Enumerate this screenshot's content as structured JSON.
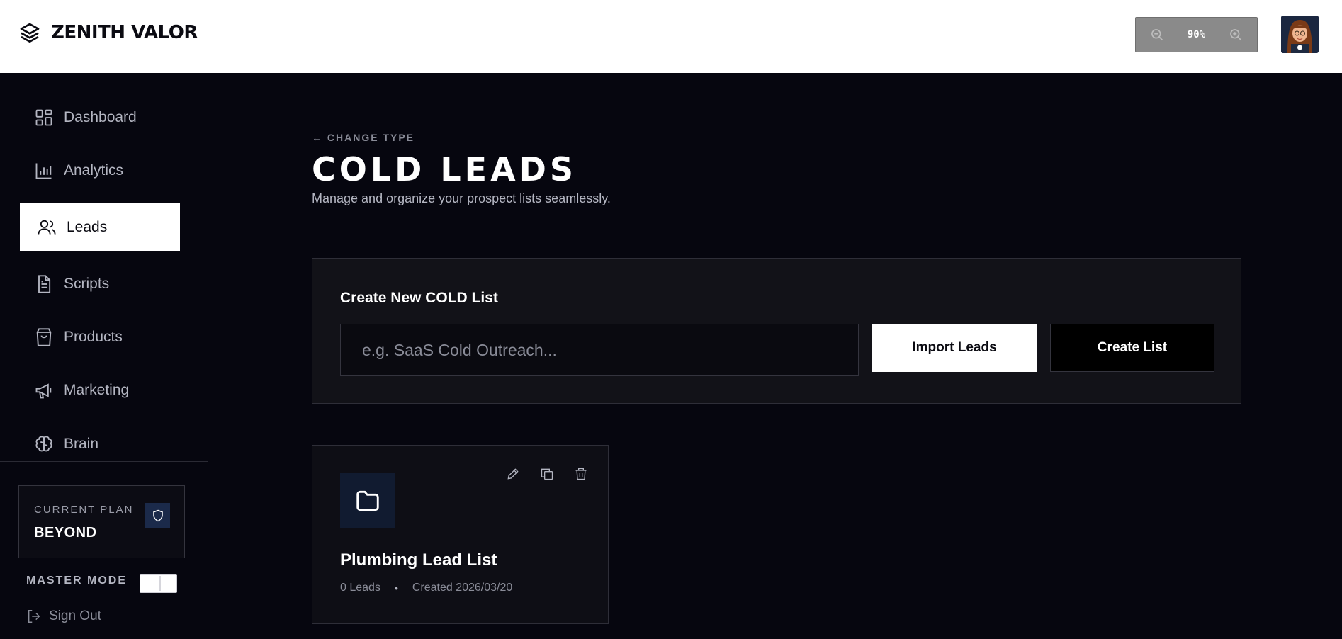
{
  "header": {
    "brand_name": "ZENITH VALOR",
    "zoom_level": "90%"
  },
  "sidebar": {
    "items": [
      {
        "label": "Dashboard",
        "icon": "dashboard-icon"
      },
      {
        "label": "Analytics",
        "icon": "bar-chart-icon"
      },
      {
        "label": "Leads",
        "icon": "users-icon",
        "active": true
      },
      {
        "label": "Scripts",
        "icon": "document-icon"
      },
      {
        "label": "Products",
        "icon": "shopping-bag-icon"
      },
      {
        "label": "Marketing",
        "icon": "megaphone-icon"
      },
      {
        "label": "Brain",
        "icon": "brain-icon"
      }
    ],
    "plan": {
      "label": "CURRENT PLAN",
      "name": "BEYOND"
    },
    "master_mode_label": "MASTER MODE",
    "sign_out_label": "Sign Out"
  },
  "main": {
    "back_label": "← CHANGE TYPE",
    "title": "COLD LEADS",
    "subtitle": "Manage and organize your prospect lists seamlessly.",
    "create_panel": {
      "title": "Create New COLD List",
      "input_placeholder": "e.g. SaaS Cold Outreach...",
      "input_value": "",
      "import_label": "Import Leads",
      "create_label": "Create List"
    },
    "lists": [
      {
        "name": "Plumbing Lead List",
        "leads": "0 Leads",
        "separator": "•",
        "created": "Created 2026/03/20"
      }
    ]
  },
  "colors": {
    "background": "#06060f",
    "panel": "#121218",
    "accent_tile": "#111b30",
    "header": "#ffffff"
  }
}
